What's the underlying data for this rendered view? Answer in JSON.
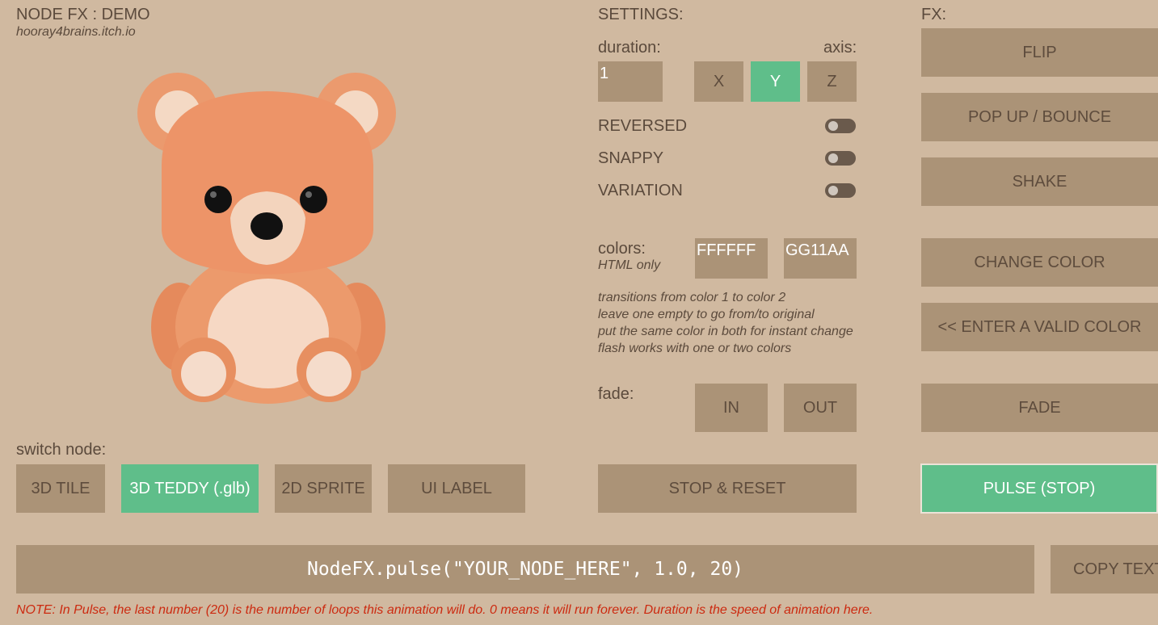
{
  "header": {
    "title": "NODE FX : DEMO",
    "subtitle": "hooray4brains.itch.io"
  },
  "preview": {
    "icon": "teddy-bear-icon"
  },
  "switch_node": {
    "label": "switch node:",
    "buttons": [
      "3D TILE",
      "3D TEDDY (.glb)",
      "2D SPRITE",
      "UI LABEL"
    ],
    "selected": "3D TEDDY (.glb)"
  },
  "settings": {
    "title": "SETTINGS:",
    "duration_label": "duration:",
    "duration_value": "1",
    "axis_label": "axis:",
    "axes": [
      "X",
      "Y",
      "Z"
    ],
    "axis_selected": "Y",
    "toggles": [
      {
        "label": "REVERSED",
        "on": false
      },
      {
        "label": "SNAPPY",
        "on": false
      },
      {
        "label": "VARIATION",
        "on": false
      }
    ],
    "colors_label": "colors:",
    "colors_sub": "HTML only",
    "color1": "FFFFFF",
    "color2": "GG11AA",
    "hints": [
      "transitions from color 1 to color 2",
      "leave one empty to go from/to original",
      "put the same color in both for instant change",
      "flash works with one or two colors"
    ],
    "fade_label": "fade:",
    "fade_in": "IN",
    "fade_out": "OUT",
    "stop_reset": "STOP & RESET"
  },
  "fx": {
    "title": "FX:",
    "buttons": [
      "FLIP",
      "POP UP / BOUNCE",
      "SHAKE",
      "CHANGE COLOR",
      "<< ENTER A VALID COLOR",
      "FADE",
      "PULSE (STOP)"
    ],
    "active": "PULSE (STOP)"
  },
  "code": {
    "text": "NodeFX.pulse(\"YOUR_NODE_HERE\", 1.0, 20)",
    "copy_label": "COPY TEXT"
  },
  "note": "NOTE: In Pulse, the last number (20) is the number of loops this animation will do. 0 means it will run forever. Duration is the speed of animation here.",
  "colors": {
    "background": "#d0b9a0",
    "button": "#ab9377",
    "accent_green": "#5fbe8a",
    "note_red": "#cc2a10"
  }
}
